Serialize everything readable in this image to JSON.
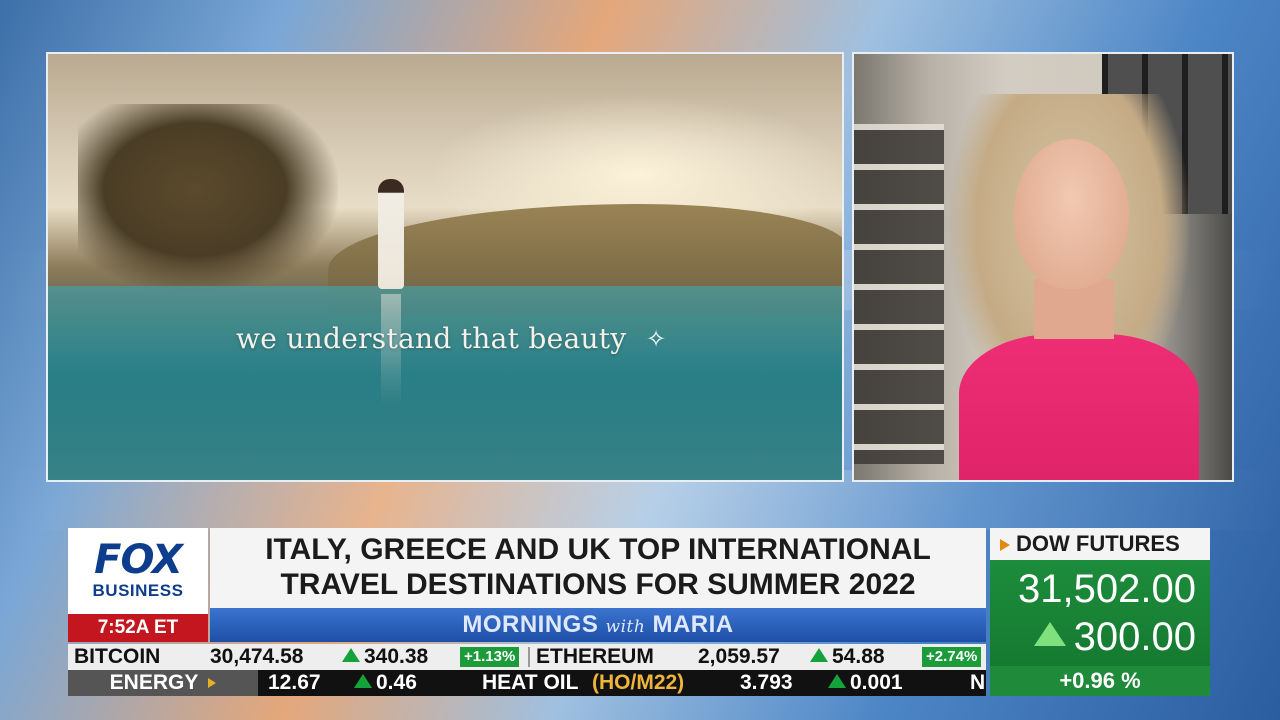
{
  "video": {
    "left_caption": "we understand that beauty"
  },
  "brand": {
    "fox": "FOX",
    "business": "BUSINESS"
  },
  "time": "7:52A ET",
  "headline": {
    "line1": "ITALY, GREECE AND UK TOP INTERNATIONAL",
    "line2": "TRAVEL DESTINATIONS FOR SUMMER 2022"
  },
  "show": {
    "part1": "MORNINGS",
    "with": "with",
    "part2": "MARIA"
  },
  "dow": {
    "title": "DOW FUTURES",
    "value": "31,502.00",
    "change": "300.00",
    "pct": "+0.96 %"
  },
  "ticker_crypto": {
    "bitcoin_label": "BITCOIN",
    "bitcoin_price": "30,474.58",
    "bitcoin_change": "340.38",
    "bitcoin_pct": "+1.13%",
    "eth_label": "ETHEREUM",
    "eth_price": "2,059.57",
    "eth_change": "54.88",
    "eth_pct": "+2.74%"
  },
  "ticker_energy": {
    "sector": "ENERGY",
    "val1": "12.67",
    "chg1": "0.46",
    "heat_label": "HEAT OIL",
    "heat_code": "(HO/M22)",
    "heat_price": "3.793",
    "heat_change": "0.001",
    "next_letter": "N"
  },
  "colors": {
    "fox_blue": "#0e3d8e",
    "time_red": "#c3161f",
    "show_blue": "#1e4fa6",
    "dow_green": "#157a30",
    "up_green": "#14a33b",
    "dow_orange": "#e08a10"
  },
  "icons": {
    "dow_title": "triangle-right-icon",
    "dow_change": "triangle-up-icon",
    "caption": "sparkle-icon"
  }
}
